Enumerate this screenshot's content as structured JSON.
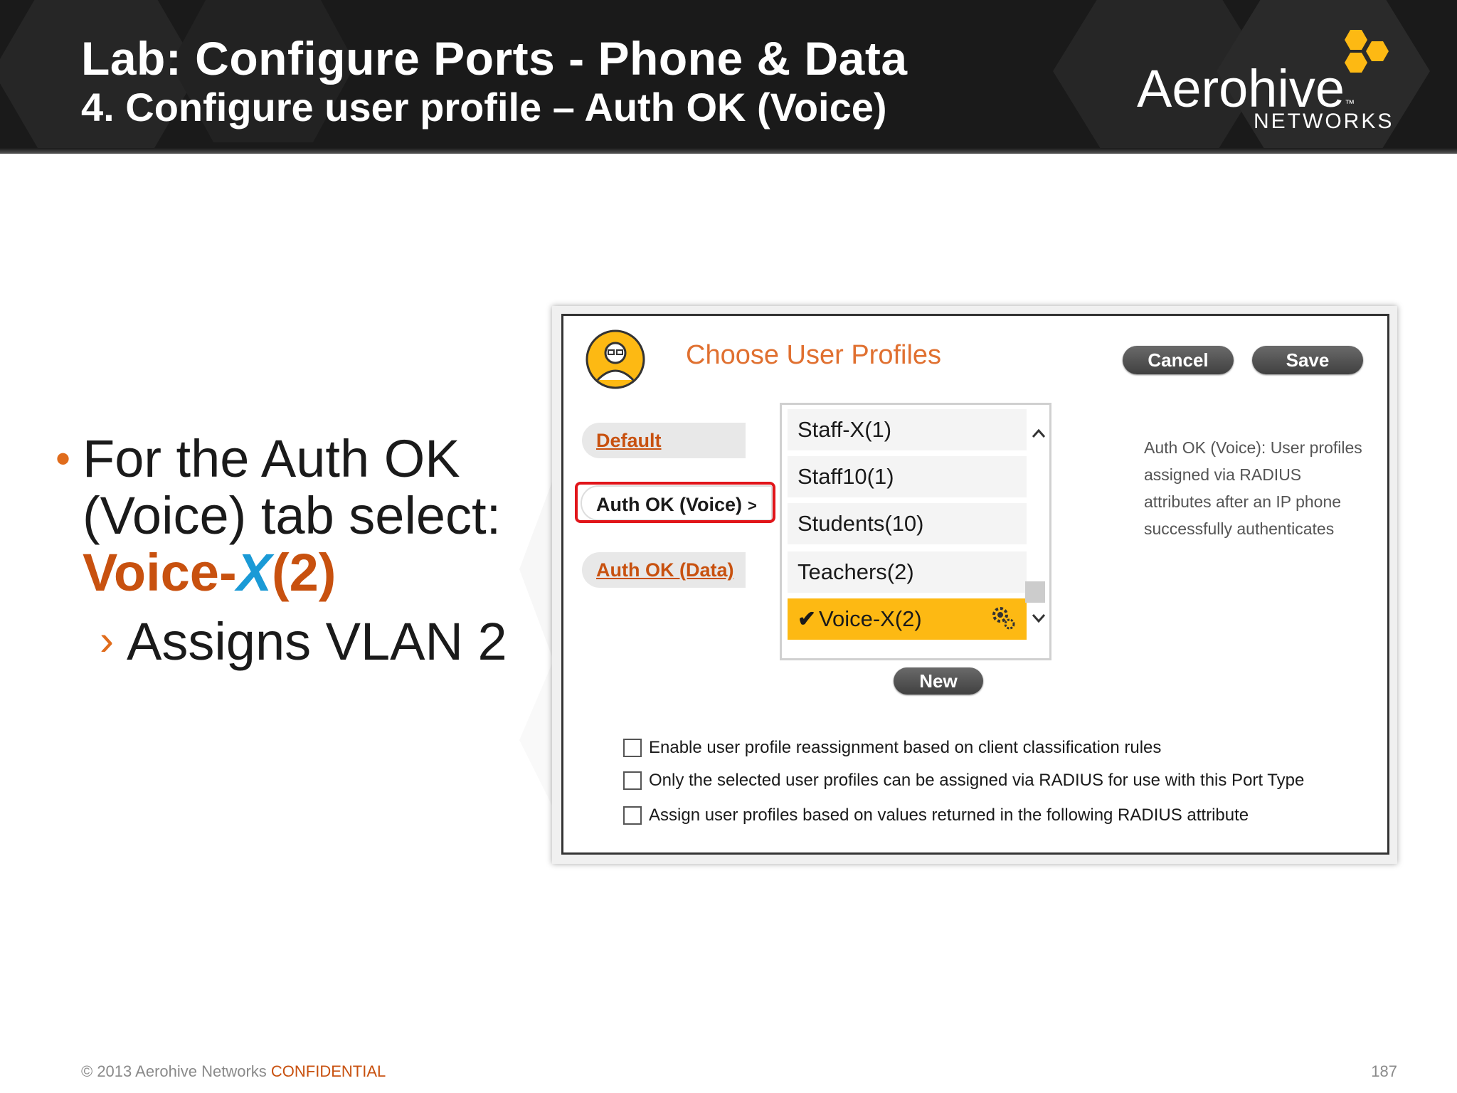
{
  "slide": {
    "title_line1": "Lab: Configure Ports  - Phone & Data",
    "title_line2": "4. Configure user profile – Auth OK (Voice)",
    "logo_name": "Aerohive",
    "logo_tm": "™",
    "logo_sub": "NETWORKS",
    "bullets": {
      "main_prefix": "For the Auth OK (Voice) tab select:",
      "highlight_a": "Voice-",
      "highlight_x": "X",
      "highlight_b": "(2)",
      "sub_chevron": "›",
      "sub": "Assigns VLAN 2"
    },
    "footer": {
      "copyright": "© 2013 Aerohive Networks",
      "confidential": "CONFIDENTIAL",
      "page_number": "187"
    },
    "colors": {
      "accent_orange": "#c8510f",
      "accent_blue": "#1a9ad6",
      "header_bg": "#1a1a1a",
      "logo_yellow": "#fdb913",
      "selection_yellow": "#fdb913",
      "highlight_red": "#e1151a"
    }
  },
  "dialog": {
    "title": "Choose User Profiles",
    "avatar_icon": "user-profile-icon",
    "cancel_label": "Cancel",
    "save_label": "Save",
    "new_label": "New",
    "tabs": [
      {
        "label": "Default"
      },
      {
        "label": "Auth OK (Voice)",
        "arrow": ">",
        "active": true
      },
      {
        "label": "Auth OK (Data)"
      }
    ],
    "profiles": [
      {
        "label": "Staff-X(1)"
      },
      {
        "label": "Staff10(1)"
      },
      {
        "label": "Students(10)"
      },
      {
        "label": "Teachers(2)"
      },
      {
        "label": "Voice-X(2)",
        "selected": true,
        "check": "✔"
      }
    ],
    "description": "Auth OK (Voice): User profiles assigned via RADIUS attributes after an IP phone successfully authenticates",
    "options": [
      {
        "label": "Enable user profile reassignment based on client classification rules",
        "checked": false
      },
      {
        "label": "Only the selected user profiles can be assigned via RADIUS for use with this Port Type",
        "checked": false
      },
      {
        "label": "Assign user profiles based on values returned in the following RADIUS attribute",
        "checked": false
      }
    ]
  }
}
